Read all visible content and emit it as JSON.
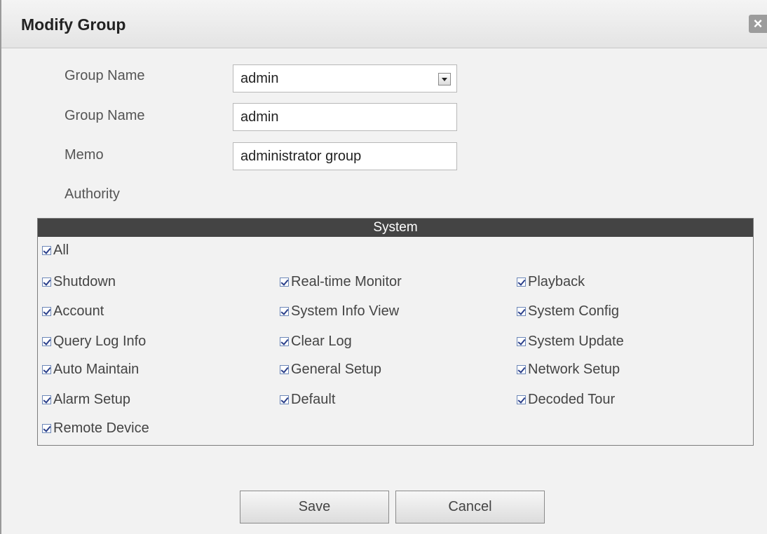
{
  "dialog": {
    "title": "Modify Group",
    "close_glyph": "×"
  },
  "form": {
    "group_select_label": "Group Name",
    "group_select_value": "admin",
    "group_name_label": "Group Name",
    "group_name_value": "admin",
    "memo_label": "Memo",
    "memo_value": "administrator group",
    "authority_label": "Authority"
  },
  "authority": {
    "section_title": "System",
    "all_label": "All",
    "items": [
      {
        "label": "Shutdown",
        "checked": true
      },
      {
        "label": "Real-time Monitor",
        "checked": true
      },
      {
        "label": "Playback",
        "checked": true
      },
      {
        "label": "Account",
        "checked": true
      },
      {
        "label": "System Info View",
        "checked": true
      },
      {
        "label": "System Config",
        "checked": true
      },
      {
        "label": "Query Log Info",
        "checked": true
      },
      {
        "label": "Clear Log",
        "checked": true
      },
      {
        "label": "System Update",
        "checked": true
      },
      {
        "label": "Auto Maintain",
        "checked": true
      },
      {
        "label": "General Setup",
        "checked": true
      },
      {
        "label": "Network Setup",
        "checked": true
      },
      {
        "label": "Alarm Setup",
        "checked": true
      },
      {
        "label": "Default",
        "checked": true
      },
      {
        "label": "Decoded Tour",
        "checked": true
      },
      {
        "label": "Remote Device",
        "checked": true
      }
    ]
  },
  "buttons": {
    "save": "Save",
    "cancel": "Cancel"
  }
}
